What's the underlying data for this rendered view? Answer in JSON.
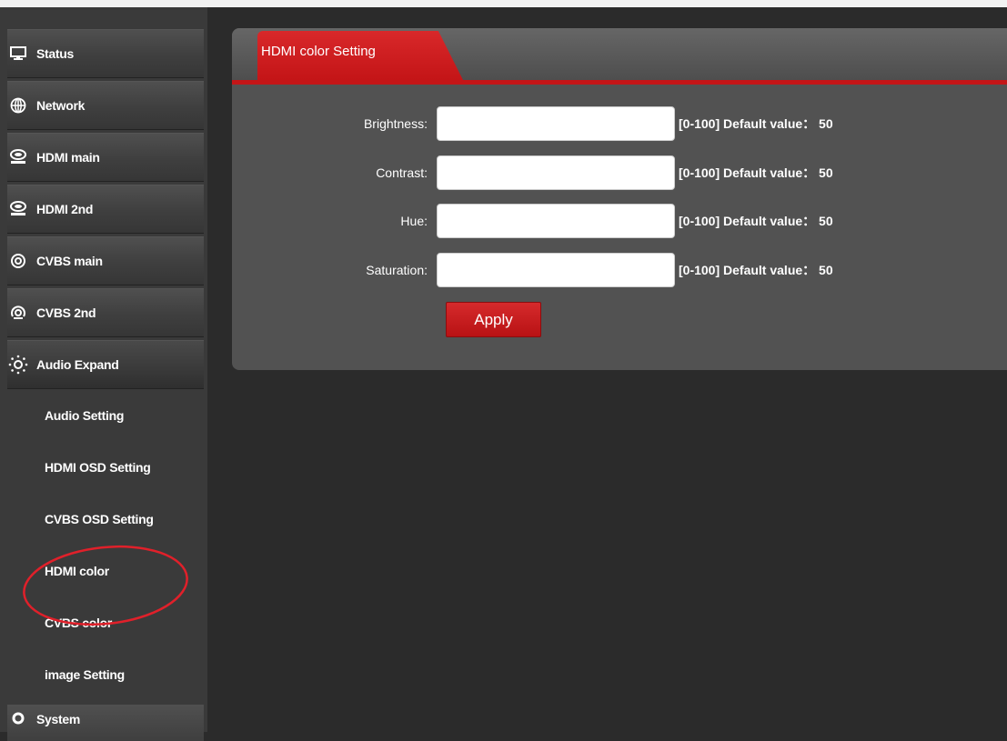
{
  "sidebar": {
    "items": [
      {
        "label": "Status",
        "icon": "monitor-icon"
      },
      {
        "label": "Network",
        "icon": "globe-icon"
      },
      {
        "label": "HDMI main",
        "icon": "hdmi-icon"
      },
      {
        "label": "HDMI 2nd",
        "icon": "hdmi-icon"
      },
      {
        "label": "CVBS main",
        "icon": "cvbs-icon"
      },
      {
        "label": "CVBS 2nd",
        "icon": "cvbs-icon"
      },
      {
        "label": "Audio Expand",
        "icon": "audio-icon"
      }
    ],
    "submenu": [
      {
        "label": "Audio Setting"
      },
      {
        "label": "HDMI OSD Setting"
      },
      {
        "label": "CVBS OSD Setting"
      },
      {
        "label": "HDMI color"
      },
      {
        "label": "CVBS color"
      },
      {
        "label": "image Setting"
      }
    ],
    "bottom_item": {
      "label": "System",
      "icon": "gear-icon"
    }
  },
  "panel": {
    "title": "HDMI color Setting",
    "fields": [
      {
        "label": "Brightness:",
        "value": "",
        "hint": "[0-100] Default value： 50"
      },
      {
        "label": "Contrast:",
        "value": "",
        "hint": "[0-100] Default value： 50"
      },
      {
        "label": "Hue:",
        "value": "",
        "hint": "[0-100] Default value： 50"
      },
      {
        "label": "Saturation:",
        "value": "",
        "hint": "[0-100] Default value： 50"
      }
    ],
    "apply_label": "Apply"
  },
  "colors": {
    "accent": "#c41517",
    "sidebar_bg": "#3a3a3a",
    "page_bg": "#2b2b2b",
    "panel_bg": "#525252",
    "annotation": "#e0202a"
  }
}
